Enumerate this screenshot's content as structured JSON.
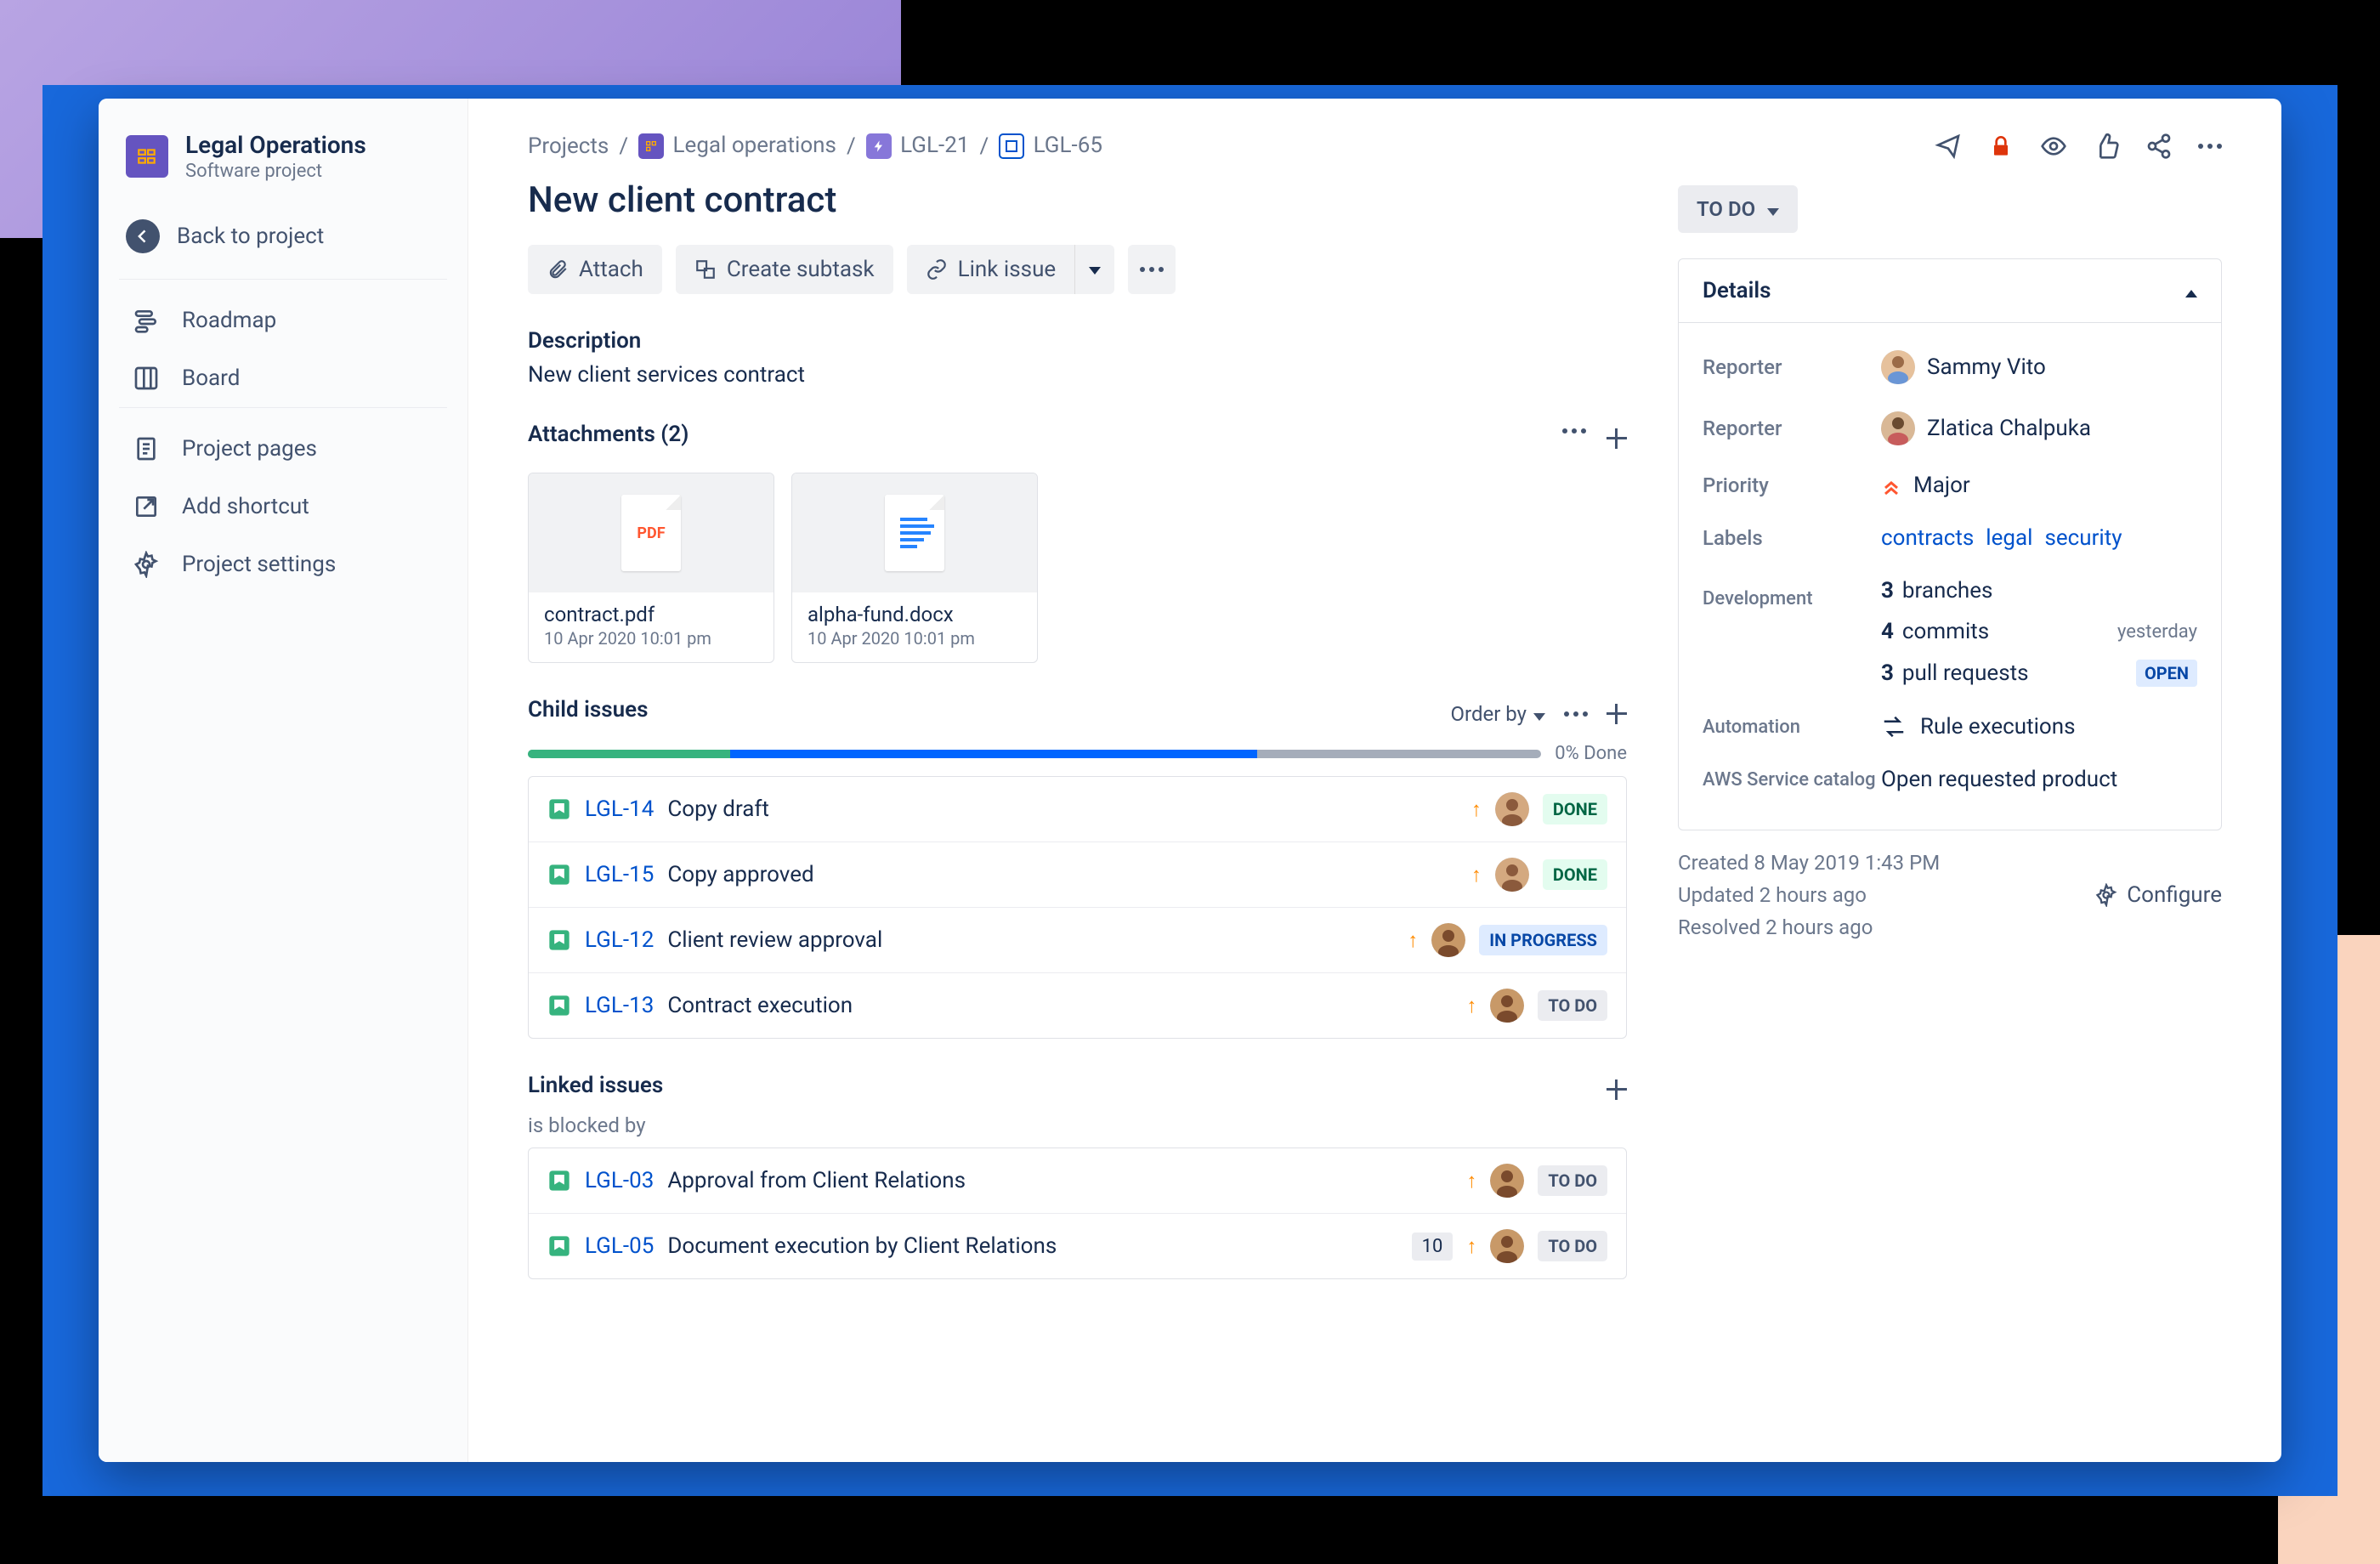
{
  "sidebar": {
    "project_name": "Legal Operations",
    "project_subtitle": "Software project",
    "back_label": "Back to project",
    "nav": [
      {
        "label": "Roadmap",
        "icon": "roadmap"
      },
      {
        "label": "Board",
        "icon": "board"
      }
    ],
    "nav2": [
      {
        "label": "Project pages",
        "icon": "pages"
      },
      {
        "label": "Add shortcut",
        "icon": "shortcut"
      },
      {
        "label": "Project settings",
        "icon": "settings"
      }
    ]
  },
  "breadcrumb": {
    "root": "Projects",
    "project": "Legal operations",
    "epic": "LGL-21",
    "current": "LGL-65"
  },
  "issue": {
    "title": "New client contract",
    "actions": {
      "attach": "Attach",
      "subtask": "Create subtask",
      "link": "Link issue"
    },
    "description_heading": "Description",
    "description": "New client services contract"
  },
  "attachments": {
    "heading": "Attachments (2)",
    "items": [
      {
        "name": "contract.pdf",
        "date": "10 Apr 2020 10:01 pm",
        "type": "pdf"
      },
      {
        "name": "alpha-fund.docx",
        "date": "10 Apr 2020 10:01 pm",
        "type": "docx"
      }
    ]
  },
  "child_issues": {
    "heading": "Child issues",
    "order_label": "Order by",
    "progress": {
      "green": 20,
      "blue": 52,
      "label": "0% Done"
    },
    "items": [
      {
        "key": "LGL-14",
        "summary": "Copy draft",
        "status": "DONE",
        "status_cls": "done"
      },
      {
        "key": "LGL-15",
        "summary": "Copy approved",
        "status": "DONE",
        "status_cls": "done"
      },
      {
        "key": "LGL-12",
        "summary": "Client review approval",
        "status": "IN PROGRESS",
        "status_cls": "progress"
      },
      {
        "key": "LGL-13",
        "summary": "Contract execution",
        "status": "TO DO",
        "status_cls": "todo"
      }
    ]
  },
  "linked_issues": {
    "heading": "Linked issues",
    "relation": "is blocked by",
    "items": [
      {
        "key": "LGL-03",
        "summary": "Approval from Client Relations",
        "status": "TO DO",
        "status_cls": "todo",
        "count": null
      },
      {
        "key": "LGL-05",
        "summary": "Document execution by Client Relations",
        "status": "TO DO",
        "status_cls": "todo",
        "count": "10"
      }
    ]
  },
  "top_actions": {
    "status": "TO DO"
  },
  "details": {
    "heading": "Details",
    "reporter_label": "Reporter",
    "reporter1": "Sammy Vito",
    "reporter2": "Zlatica Chalpuka",
    "priority_label": "Priority",
    "priority": "Major",
    "labels_label": "Labels",
    "labels": [
      "contracts",
      "legal",
      "security"
    ],
    "dev_label": "Development",
    "branches_n": "3",
    "branches_t": "branches",
    "commits_n": "4",
    "commits_t": "commits",
    "commits_meta": "yesterday",
    "pr_n": "3",
    "pr_t": "pull requests",
    "pr_badge": "OPEN",
    "automation_label": "Automation",
    "automation_val": "Rule executions",
    "aws_label": "AWS Service catalog",
    "aws_val": "Open requested product"
  },
  "meta": {
    "created": "Created 8 May 2019 1:43 PM",
    "updated": "Updated 2 hours ago",
    "resolved": "Resolved 2 hours ago",
    "configure": "Configure"
  }
}
